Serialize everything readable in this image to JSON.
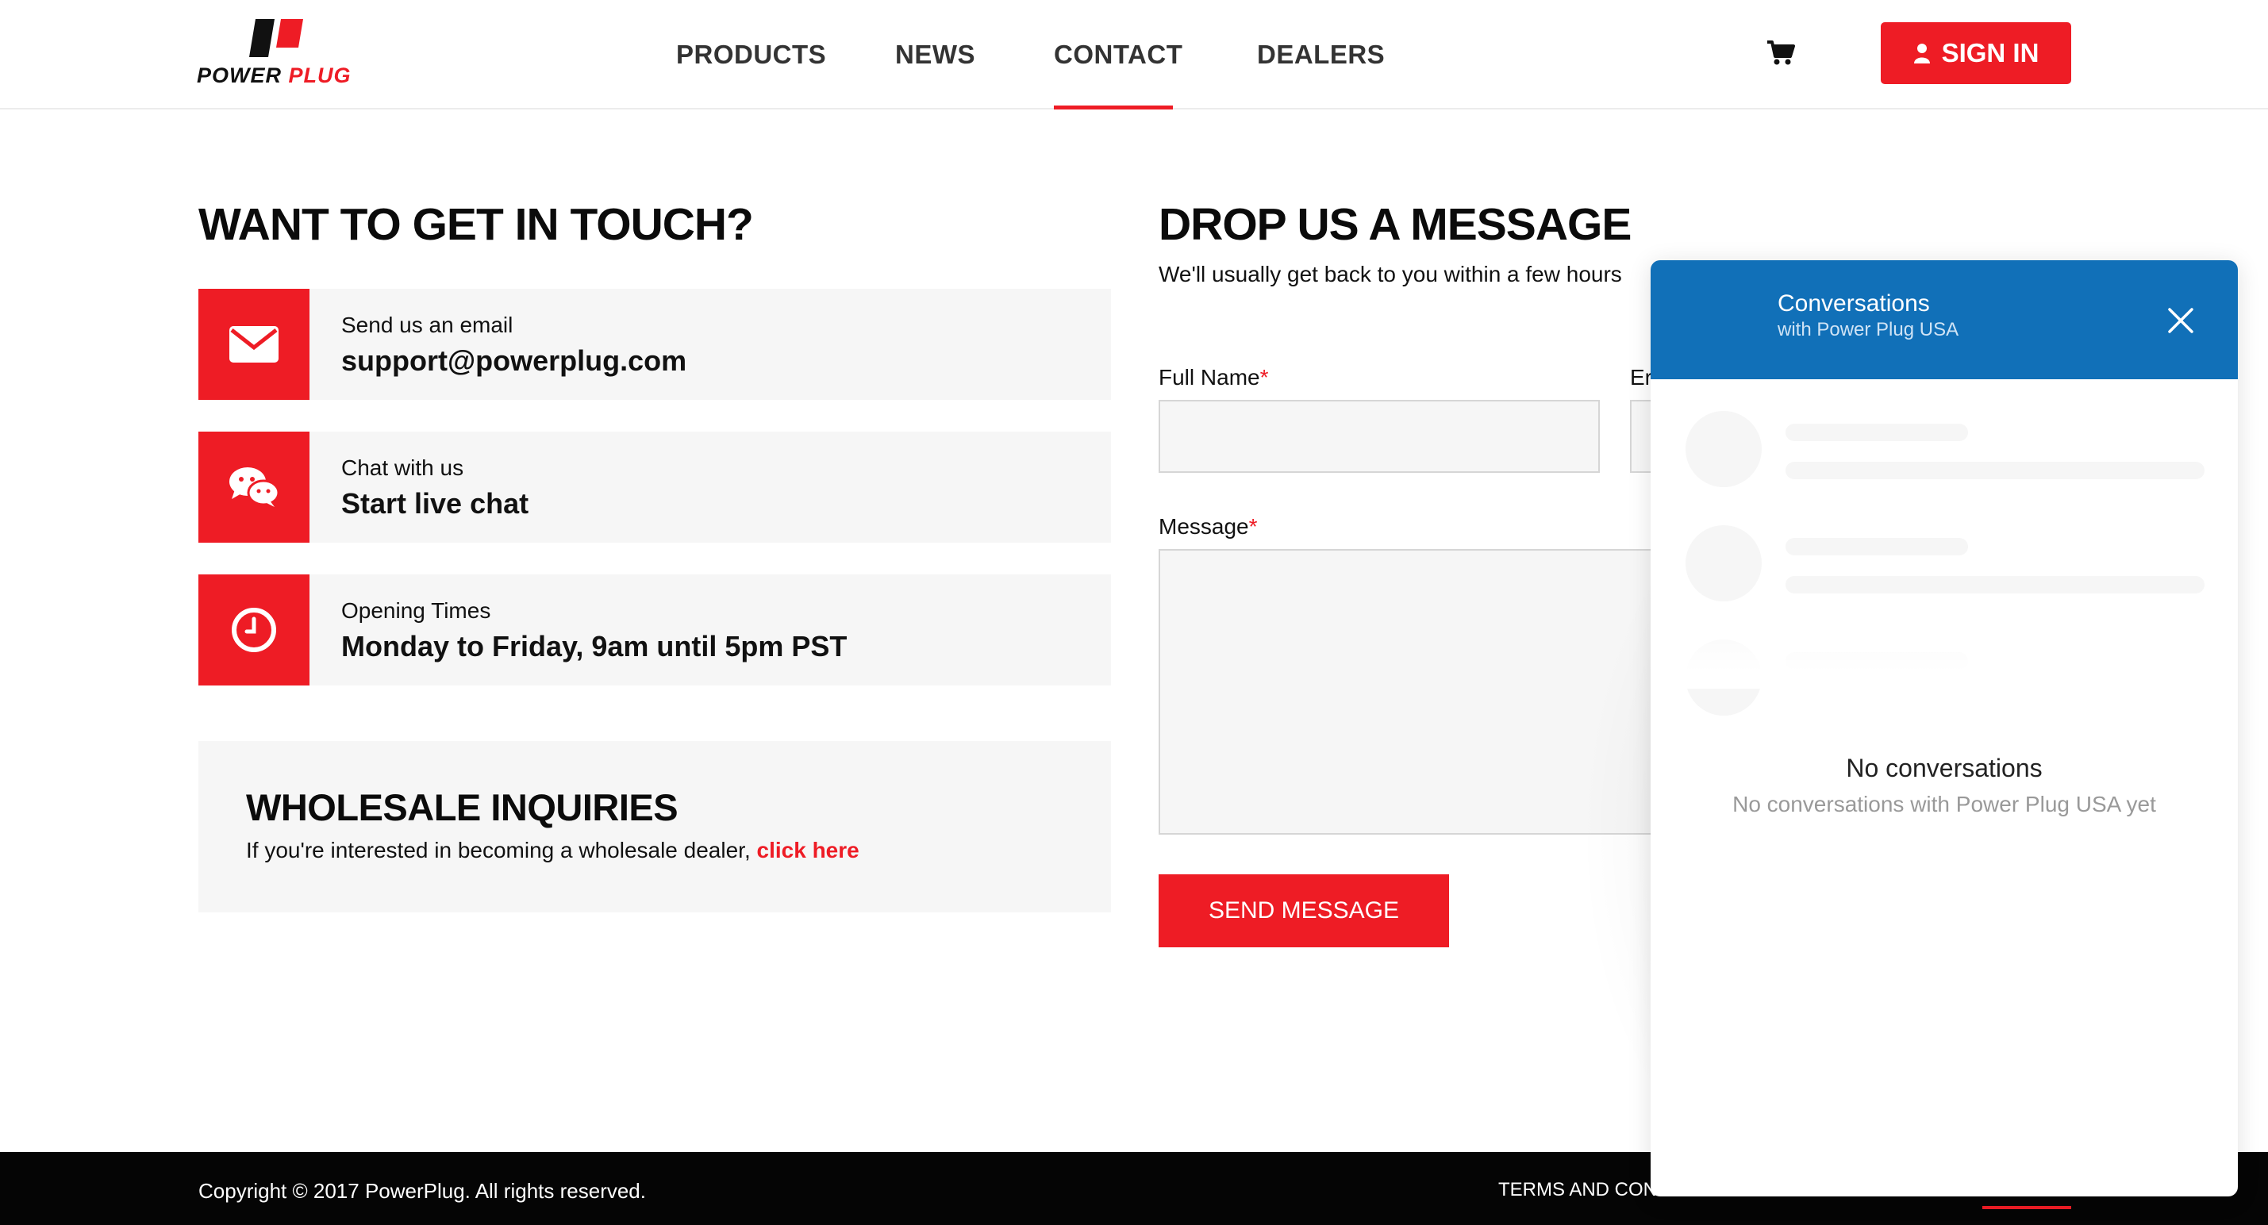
{
  "brand": {
    "logo_word_1": "POWER",
    "logo_word_2": "PLUG",
    "accent_color": "#ee1c25",
    "chat_color": "#1170b8"
  },
  "nav": {
    "items": [
      {
        "label": "PRODUCTS"
      },
      {
        "label": "NEWS"
      },
      {
        "label": "CONTACT",
        "active": true
      },
      {
        "label": "DEALERS"
      }
    ],
    "cart_icon": "shopping-cart-icon",
    "signin_label": "SIGN IN",
    "signin_icon": "user-icon"
  },
  "contact": {
    "heading": "WANT TO GET IN TOUCH?",
    "cards": [
      {
        "icon": "envelope-icon",
        "small": "Send us an email",
        "big": "support@powerplug.com"
      },
      {
        "icon": "chat-bubbles-icon",
        "small": "Chat with us",
        "big": "Start live chat"
      },
      {
        "icon": "clock-icon",
        "small": "Opening Times",
        "big": "Monday to Friday, 9am until 5pm PST"
      }
    ],
    "wholesale": {
      "title": "WHOLESALE INQUIRIES",
      "text": "If you're interested in becoming a wholesale dealer, ",
      "link": "click here"
    }
  },
  "form": {
    "heading": "DROP US A MESSAGE",
    "subheading": "We'll usually get back to you within a few hours",
    "full_name_label": "Full Name",
    "email_label_partial": "Er",
    "message_label": "Message",
    "required_marker": "*",
    "send_label": "SEND MESSAGE"
  },
  "footer": {
    "copyright": "Copyright © 2017 PowerPlug. All rights reserved.",
    "terms_partial": "TERMS AND CON"
  },
  "chat": {
    "title": "Conversations",
    "subtitle": "with Power Plug USA",
    "empty_title": "No conversations",
    "empty_subtitle": "No conversations with Power Plug USA yet"
  }
}
